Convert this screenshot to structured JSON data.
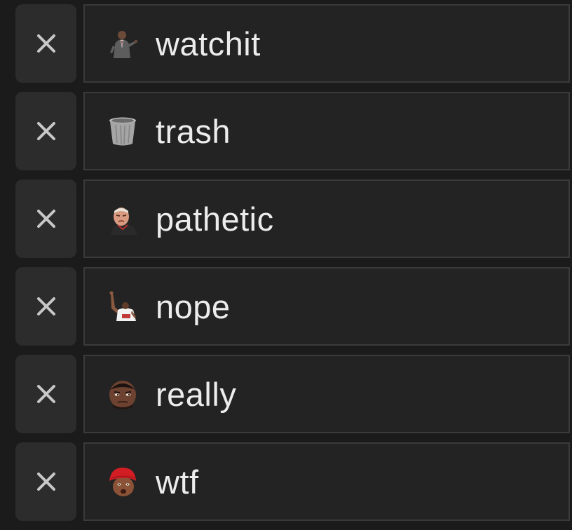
{
  "colors": {
    "background": "#1b1b1b",
    "button_bg": "#2c2c2c",
    "field_bg": "#232323",
    "field_border": "#3a3a3a",
    "text": "#ececec",
    "x_icon": "#c8c8c8"
  },
  "commands": [
    {
      "name": "watchit",
      "icon": "man-in-suit-pointing-icon"
    },
    {
      "name": "trash",
      "icon": "trash-can-icon"
    },
    {
      "name": "pathetic",
      "icon": "angry-man-face-icon"
    },
    {
      "name": "nope",
      "icon": "person-raising-hand-icon"
    },
    {
      "name": "really",
      "icon": "skeptical-man-face-icon"
    },
    {
      "name": "wtf",
      "icon": "man-red-beanie-icon"
    }
  ]
}
